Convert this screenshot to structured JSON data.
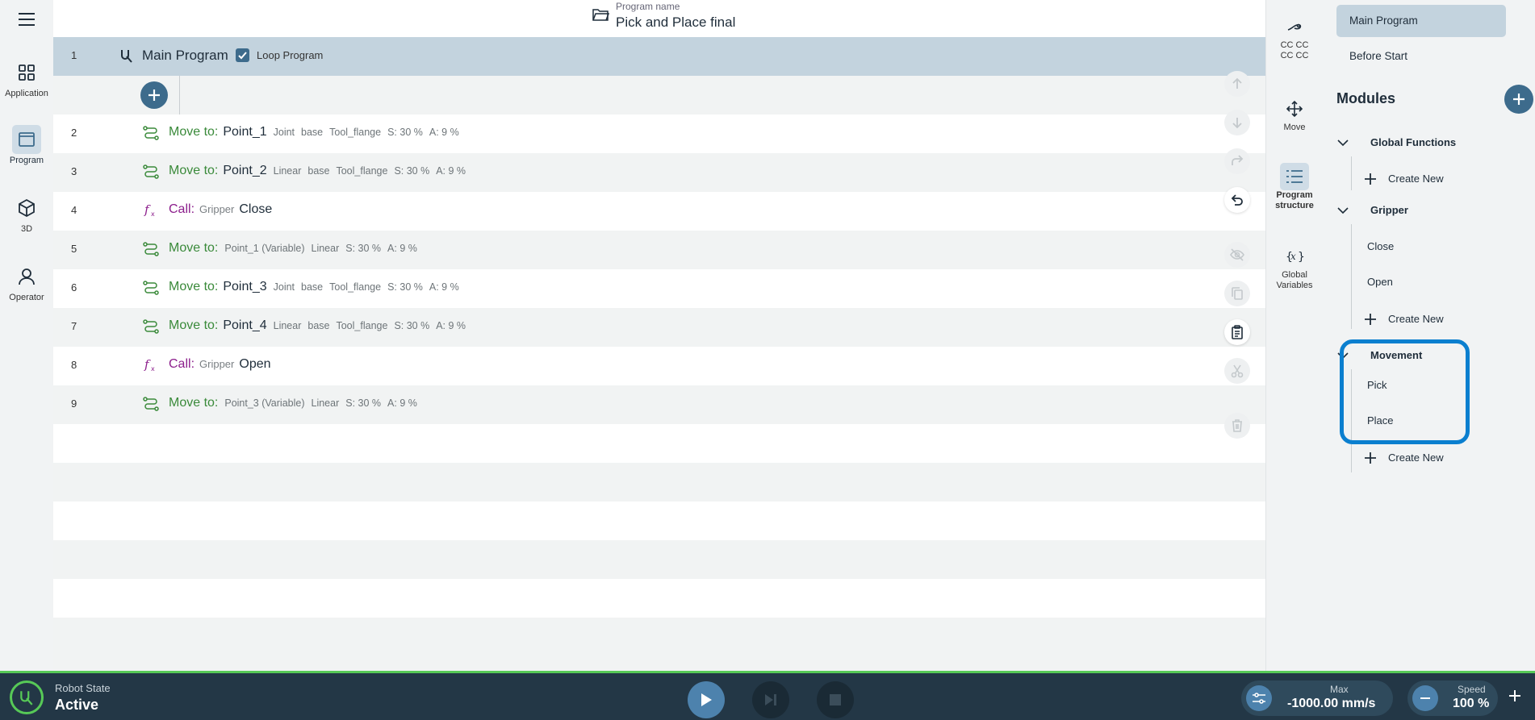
{
  "left_nav": {
    "menu_icon": "hamburger-icon",
    "items": [
      {
        "label": "Application",
        "icon": "grid-icon"
      },
      {
        "label": "Program",
        "icon": "window-icon"
      },
      {
        "label": "3D",
        "icon": "cube-icon"
      },
      {
        "label": "Operator",
        "icon": "user-icon"
      }
    ],
    "active": "Program"
  },
  "header": {
    "program_name_label": "Program name",
    "program_name": "Pick and Place final"
  },
  "tree": {
    "main": {
      "number": "1",
      "title": "Main Program",
      "loop_label": "Loop Program",
      "loop_checked": true
    },
    "rows": [
      {
        "number": "2",
        "type": "move",
        "keyword": "Move to:",
        "name": "Point_1",
        "meta": [
          "Joint",
          "base",
          "Tool_flange",
          "S: 30 %",
          "A: 9 %"
        ]
      },
      {
        "number": "3",
        "type": "move",
        "keyword": "Move to:",
        "name": "Point_2",
        "meta": [
          "Linear",
          "base",
          "Tool_flange",
          "S: 30 %",
          "A: 9 %"
        ]
      },
      {
        "number": "4",
        "type": "call",
        "keyword": "Call:",
        "module": "Gripper",
        "name": "Close"
      },
      {
        "number": "5",
        "type": "move-var",
        "keyword": "Move to:",
        "meta": [
          "Point_1 (Variable)",
          "Linear",
          "S: 30 %",
          "A: 9 %"
        ]
      },
      {
        "number": "6",
        "type": "move",
        "keyword": "Move to:",
        "name": "Point_3",
        "meta": [
          "Joint",
          "base",
          "Tool_flange",
          "S: 30 %",
          "A: 9 %"
        ]
      },
      {
        "number": "7",
        "type": "move",
        "keyword": "Move to:",
        "name": "Point_4",
        "meta": [
          "Linear",
          "base",
          "Tool_flange",
          "S: 30 %",
          "A: 9 %"
        ]
      },
      {
        "number": "8",
        "type": "call",
        "keyword": "Call:",
        "module": "Gripper",
        "name": "Open"
      },
      {
        "number": "9",
        "type": "move-var",
        "keyword": "Move to:",
        "meta": [
          "Point_3 (Variable)",
          "Linear",
          "S: 30 %",
          "A: 9 %"
        ]
      }
    ]
  },
  "actions": [
    "move-up-icon",
    "move-down-icon",
    "redo-icon",
    "undo-icon",
    "hide-icon",
    "copy-icon",
    "paste-icon",
    "cut-icon",
    "delete-icon"
  ],
  "tool_strip": [
    {
      "label": "CC CC\nCC CC",
      "icon": "robot-arm-icon"
    },
    {
      "label": "Move",
      "icon": "move-arrows-icon"
    },
    {
      "label": "Program\nstructure",
      "icon": "list-icon"
    },
    {
      "label": "Global\nVariables",
      "icon": "variable-icon"
    }
  ],
  "structure": {
    "segments": [
      "Main Program",
      "Before Start"
    ],
    "modules_title": "Modules",
    "modules": [
      {
        "title": "Global Functions",
        "items": [],
        "create_label": "Create New"
      },
      {
        "title": "Gripper",
        "items": [
          "Close",
          "Open"
        ],
        "create_label": "Create New"
      },
      {
        "title": "Movement",
        "items": [
          "Pick",
          "Place"
        ],
        "create_label": "Create New"
      }
    ]
  },
  "bottom": {
    "state_label": "Robot State",
    "state_value": "Active",
    "max_label": "Max",
    "max_value": "-1000.00 mm/s",
    "speed_label": "Speed",
    "speed_value": "100 %"
  },
  "colors": {
    "accent": "#3d6b8c",
    "move": "#3a8a3a",
    "call": "#8c1e8c",
    "highlight": "#0b7fcf",
    "bar": "#233746",
    "active": "#57c957"
  }
}
